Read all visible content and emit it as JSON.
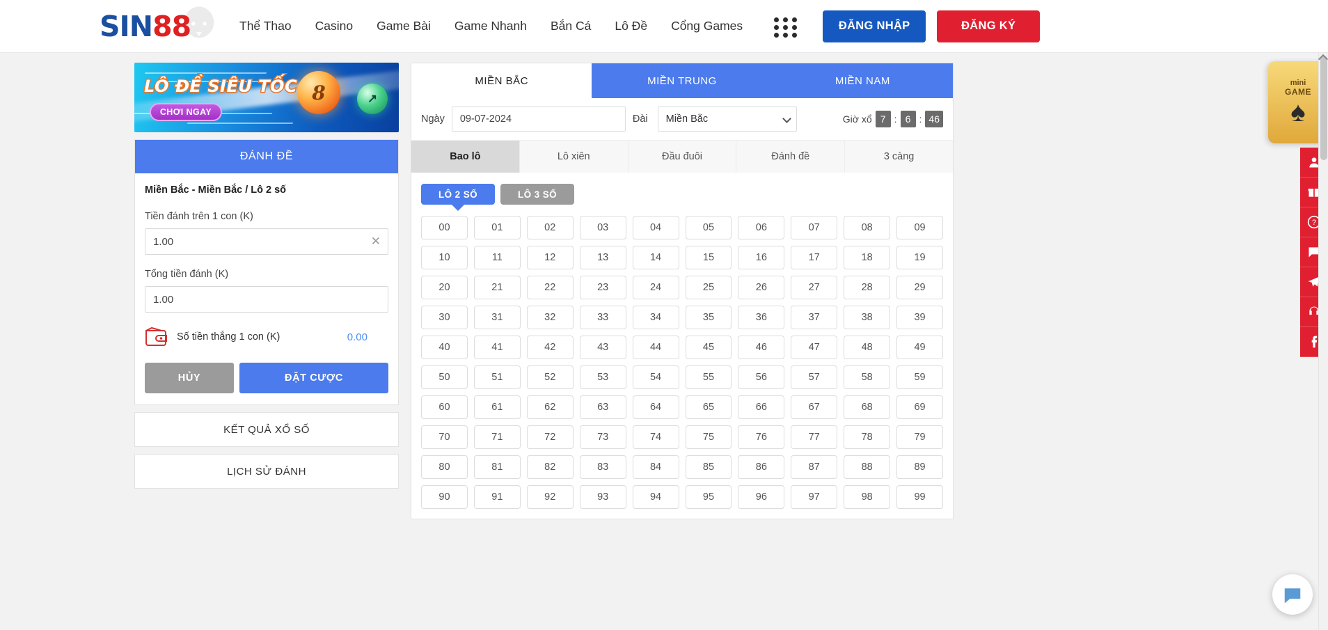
{
  "header": {
    "logo": {
      "part1": "SIN",
      "part2": "88",
      "icon": "lion-icon"
    },
    "nav": [
      {
        "label": "Thể Thao"
      },
      {
        "label": "Casino"
      },
      {
        "label": "Game Bài"
      },
      {
        "label": "Game Nhanh"
      },
      {
        "label": "Bắn Cá"
      },
      {
        "label": "Lô Đề"
      },
      {
        "label": "Cổng Games"
      }
    ],
    "apps_icon": "grid-dots-icon",
    "login_label": "ĐĂNG NHẬP",
    "register_label": "ĐĂNG KÝ",
    "login_color": "#1559c0",
    "register_color": "#e02030"
  },
  "banner": {
    "title": "LÔ ĐỀ SIÊU TỐC",
    "cta": "CHƠI NGAY",
    "ball_number": "8"
  },
  "bet_panel": {
    "title": "ĐÁNH ĐỀ",
    "summary": "Miền Bắc - Miền Bắc / Lô 2 số",
    "amount_label": "Tiền đánh trên 1 con (K)",
    "amount_value": "1.00",
    "total_label": "Tổng tiền đánh (K)",
    "total_value": "1.00",
    "win_label": "Số tiền thắng 1 con (K)",
    "win_value": "0.00",
    "win_color": "#4b8df8",
    "cancel_label": "HỦY",
    "submit_label": "ĐẶT CƯỢC",
    "wallet_icon": "wallet-icon",
    "clear_icon": "close-icon"
  },
  "side_links": [
    {
      "label": "KẾT QUẢ XỔ SỐ"
    },
    {
      "label": "LỊCH SỬ ĐÁNH"
    }
  ],
  "lottery": {
    "region_tabs": [
      {
        "label": "MIỀN BẮC",
        "active": true
      },
      {
        "label": "MIỀN TRUNG",
        "active": false
      },
      {
        "label": "MIỀN NAM",
        "active": false
      }
    ],
    "date_label": "Ngày",
    "date_value": "09-07-2024",
    "station_label": "Đài",
    "station_value": "Miền Bắc",
    "timer_label": "Giờ xổ",
    "timer": {
      "hours": "7",
      "minutes": "6",
      "seconds": "46",
      "separator": ":"
    },
    "bet_type_tabs": [
      {
        "label": "Bao lô",
        "active": true
      },
      {
        "label": "Lô xiên",
        "active": false
      },
      {
        "label": "Đầu đuôi",
        "active": false
      },
      {
        "label": "Đánh đề",
        "active": false
      },
      {
        "label": "3 càng",
        "active": false
      }
    ],
    "digit_modes": [
      {
        "label": "LÔ 2 SỐ",
        "active": true
      },
      {
        "label": "LÔ 3 SỐ",
        "active": false
      }
    ],
    "numbers": [
      "00",
      "01",
      "02",
      "03",
      "04",
      "05",
      "06",
      "07",
      "08",
      "09",
      "10",
      "11",
      "12",
      "13",
      "14",
      "15",
      "16",
      "17",
      "18",
      "19",
      "20",
      "21",
      "22",
      "23",
      "24",
      "25",
      "26",
      "27",
      "28",
      "29",
      "30",
      "31",
      "32",
      "33",
      "34",
      "35",
      "36",
      "37",
      "38",
      "39",
      "40",
      "41",
      "42",
      "43",
      "44",
      "45",
      "46",
      "47",
      "48",
      "49",
      "50",
      "51",
      "52",
      "53",
      "54",
      "55",
      "56",
      "57",
      "58",
      "59",
      "60",
      "61",
      "62",
      "63",
      "64",
      "65",
      "66",
      "67",
      "68",
      "69",
      "70",
      "71",
      "72",
      "73",
      "74",
      "75",
      "76",
      "77",
      "78",
      "79",
      "80",
      "81",
      "82",
      "83",
      "84",
      "85",
      "86",
      "87",
      "88",
      "89",
      "90",
      "91",
      "92",
      "93",
      "94",
      "95",
      "96",
      "97",
      "98",
      "99"
    ]
  },
  "minigame": {
    "label_top": "mini",
    "label_bottom": "GAME",
    "icon": "spade-icon"
  },
  "rail": [
    {
      "icon": "user-icon"
    },
    {
      "icon": "gift-icon"
    },
    {
      "icon": "question-icon"
    },
    {
      "icon": "chat-icon"
    },
    {
      "icon": "telegram-icon"
    },
    {
      "icon": "headset-icon"
    },
    {
      "icon": "facebook-icon"
    }
  ],
  "chat_widget": {
    "icon": "chat-bubble-icon"
  }
}
